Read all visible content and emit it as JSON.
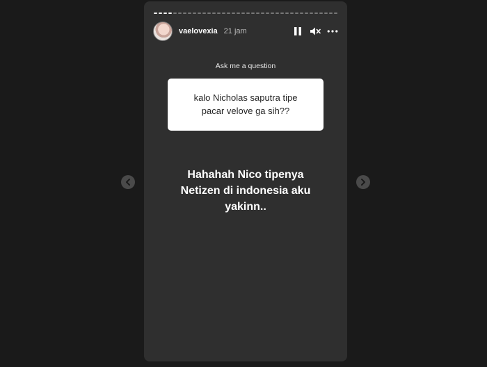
{
  "story": {
    "progress_segments": [
      1,
      1,
      1,
      1,
      0,
      0,
      0,
      0,
      0,
      0,
      0,
      0,
      0,
      0,
      0,
      0,
      0,
      0,
      0,
      0,
      0,
      0,
      0,
      0,
      0,
      0,
      0,
      0,
      0,
      0,
      0,
      0,
      0,
      0,
      0,
      0,
      0,
      0
    ],
    "header": {
      "username": "vaelovexia",
      "time": "21 jam",
      "icons": [
        "pause-icon",
        "mute-icon",
        "more-icon"
      ]
    },
    "ask_label": "Ask me a question",
    "question": "kalo Nicholas saputra tipe pacar velove ga sih??",
    "answer": "Hahahah Nico tipenya Netizen di indonesia aku yakinn.."
  },
  "navigation": {
    "prev_icon": "chevron-left-icon",
    "next_icon": "chevron-right-icon"
  },
  "colors": {
    "background": "#1a1a1a",
    "story_bg": "#2f2f2f",
    "card_bg": "#ffffff",
    "text_white": "#ffffff"
  }
}
